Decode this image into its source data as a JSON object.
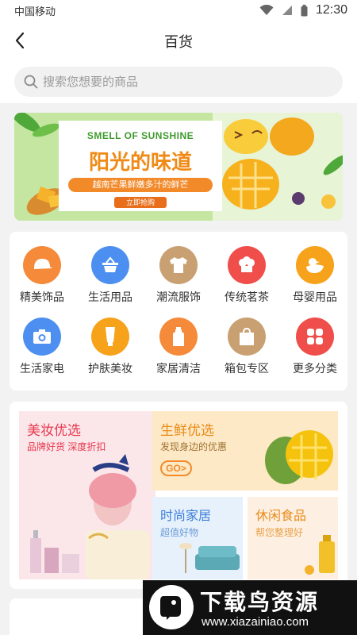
{
  "status_bar": {
    "carrier": "中国移动",
    "time": "12:30"
  },
  "header": {
    "title": "百货"
  },
  "search": {
    "placeholder": "搜索您想要的商品"
  },
  "banner": {
    "title_en": "SMELL OF SUNSHINE",
    "title_cn": "阳光的味道",
    "subtitle": "越南芒果鲜嫩多汁的鲜芒",
    "button": "立即抢购"
  },
  "categories": [
    {
      "label": "精美饰品",
      "icon": "cap-icon",
      "color": "#f58a3a"
    },
    {
      "label": "生活用品",
      "icon": "basket-icon",
      "color": "#4d8ff0"
    },
    {
      "label": "潮流服饰",
      "icon": "tshirt-icon",
      "color": "#c9a072"
    },
    {
      "label": "传统茗茶",
      "icon": "cake-icon",
      "color": "#ef4e4a"
    },
    {
      "label": "母婴用品",
      "icon": "duck-icon",
      "color": "#f7a21b"
    },
    {
      "label": "生活家电",
      "icon": "camera-icon",
      "color": "#4d8ff0"
    },
    {
      "label": "护肤美妆",
      "icon": "tube-icon",
      "color": "#f7a21b"
    },
    {
      "label": "家居清洁",
      "icon": "bottle-icon",
      "color": "#f58a3a"
    },
    {
      "label": "箱包专区",
      "icon": "bag-icon",
      "color": "#c9a072"
    },
    {
      "label": "更多分类",
      "icon": "grid-icon",
      "color": "#ef4e4a"
    }
  ],
  "promos": {
    "beauty": {
      "title": "美妆优选",
      "subtitle": "品牌好货 深度折扣"
    },
    "fresh": {
      "title": "生鲜优选",
      "subtitle": "发现身边的优惠",
      "button": "GO>"
    },
    "home": {
      "title": "时尚家居",
      "subtitle": "超值好物"
    },
    "snack": {
      "title": "休闲食品",
      "subtitle": "帮您整理好"
    }
  },
  "watermark": {
    "title": "下载鸟资源",
    "url": "www.xiazainiao.com"
  },
  "colors": {
    "accent": "#f28a2a",
    "beauty_red": "#e8384f",
    "fresh_orange": "#e98b18",
    "home_blue": "#4d8ff0"
  }
}
